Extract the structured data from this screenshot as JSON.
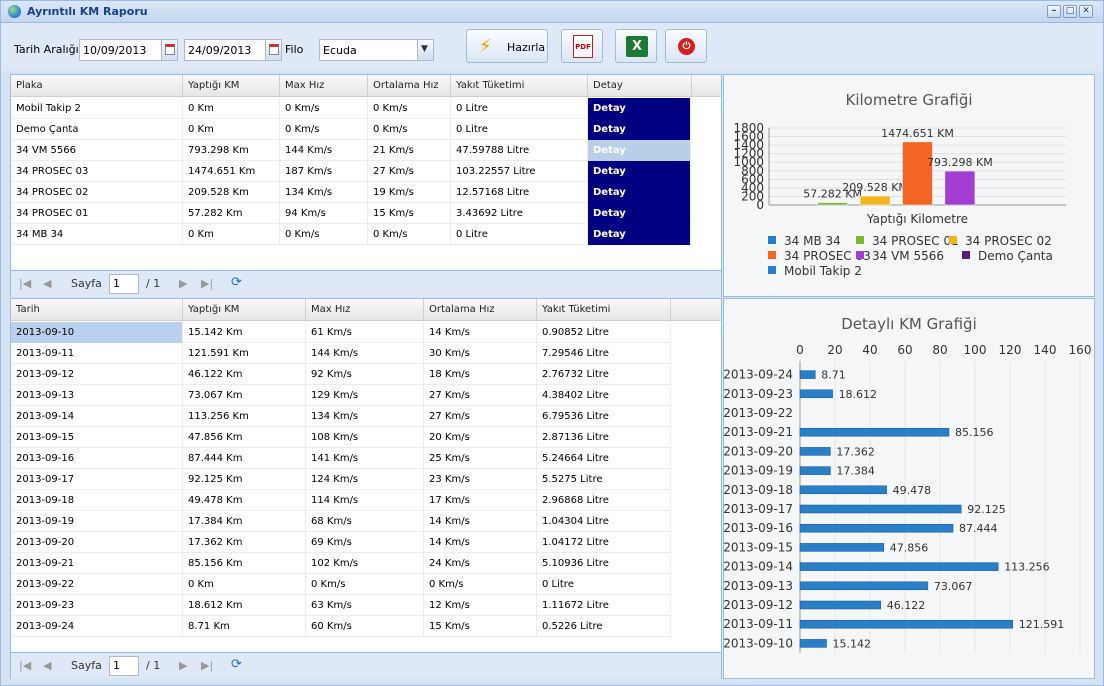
{
  "window": {
    "title": "Ayrıntılı KM Raporu"
  },
  "toolbar": {
    "date_range_label": "Tarih Aralığı",
    "start_date": "10/09/2013",
    "end_date": "24/09/2013",
    "fleet_label": "Filo",
    "fleet_value": "Ecuda",
    "prepare_label": "Hazırla"
  },
  "summary": {
    "headers": [
      "Plaka",
      "Yaptığı KM",
      "Max Hız",
      "Ortalama Hız",
      "Yakıt Tüketimi",
      "Detay"
    ],
    "rows": [
      [
        "Mobil Takip 2",
        "0 Km",
        "0 Km/s",
        "0 Km/s",
        "0 Litre",
        "Detay"
      ],
      [
        "Demo Çanta",
        "0 Km",
        "0 Km/s",
        "0 Km/s",
        "0 Litre",
        "Detay"
      ],
      [
        "34 VM 5566",
        "793.298 Km",
        "144 Km/s",
        "21 Km/s",
        "47.59788 Litre",
        "Detay"
      ],
      [
        "34 PROSEC 03",
        "1474.651 Km",
        "187 Km/s",
        "27 Km/s",
        "103.22557 Litre",
        "Detay"
      ],
      [
        "34 PROSEC 02",
        "209.528 Km",
        "134 Km/s",
        "19 Km/s",
        "12.57168 Litre",
        "Detay"
      ],
      [
        "34 PROSEC 01",
        "57.282 Km",
        "94 Km/s",
        "15 Km/s",
        "3.43692 Litre",
        "Detay"
      ],
      [
        "34 MB 34",
        "0 Km",
        "0 Km/s",
        "0 Km/s",
        "0 Litre",
        "Detay"
      ]
    ],
    "selected_row": 2
  },
  "pager1": {
    "page_label": "Sayfa",
    "page": "1",
    "total": "/ 1"
  },
  "detail": {
    "headers": [
      "Tarih",
      "Yaptığı KM",
      "Max Hız",
      "Ortalama Hız",
      "Yakıt Tüketimi"
    ],
    "rows": [
      [
        "2013-09-10",
        "15.142 Km",
        "61 Km/s",
        "14 Km/s",
        "0.90852 Litre"
      ],
      [
        "2013-09-11",
        "121.591 Km",
        "144 Km/s",
        "30 Km/s",
        "7.29546 Litre"
      ],
      [
        "2013-09-12",
        "46.122 Km",
        "92 Km/s",
        "18 Km/s",
        "2.76732 Litre"
      ],
      [
        "2013-09-13",
        "73.067 Km",
        "129 Km/s",
        "27 Km/s",
        "4.38402 Litre"
      ],
      [
        "2013-09-14",
        "113.256 Km",
        "134 Km/s",
        "27 Km/s",
        "6.79536 Litre"
      ],
      [
        "2013-09-15",
        "47.856 Km",
        "108 Km/s",
        "20 Km/s",
        "2.87136 Litre"
      ],
      [
        "2013-09-16",
        "87.444 Km",
        "141 Km/s",
        "25 Km/s",
        "5.24664 Litre"
      ],
      [
        "2013-09-17",
        "92.125 Km",
        "124 Km/s",
        "23 Km/s",
        "5.5275 Litre"
      ],
      [
        "2013-09-18",
        "49.478 Km",
        "114 Km/s",
        "17 Km/s",
        "2.96868 Litre"
      ],
      [
        "2013-09-19",
        "17.384 Km",
        "68 Km/s",
        "14 Km/s",
        "1.04304 Litre"
      ],
      [
        "2013-09-20",
        "17.362 Km",
        "69 Km/s",
        "14 Km/s",
        "1.04172 Litre"
      ],
      [
        "2013-09-21",
        "85.156 Km",
        "102 Km/s",
        "24 Km/s",
        "5.10936 Litre"
      ],
      [
        "2013-09-22",
        "0 Km",
        "0 Km/s",
        "0 Km/s",
        "0 Litre"
      ],
      [
        "2013-09-23",
        "18.612 Km",
        "63 Km/s",
        "12 Km/s",
        "1.11672 Litre"
      ],
      [
        "2013-09-24",
        "8.71 Km",
        "60 Km/s",
        "15 Km/s",
        "0.5226 Litre"
      ]
    ]
  },
  "pager2": {
    "page_label": "Sayfa",
    "page": "1",
    "total": "/ 1"
  },
  "chart_data": [
    {
      "type": "bar",
      "title": "Kilometre Grafiği",
      "xlabel": "Yaptığı Kilometre",
      "ylim": [
        0,
        1800
      ],
      "yticks": [
        0,
        200,
        400,
        600,
        800,
        1000,
        1200,
        1400,
        1600,
        1800
      ],
      "legend_placement": "bottom",
      "series": [
        {
          "name": "34 MB 34",
          "value": 0,
          "label": "",
          "color": "#1f7ed0"
        },
        {
          "name": "34 PROSEC 01",
          "value": 57.282,
          "label": "57.282 KM",
          "color": "#7cb82f"
        },
        {
          "name": "34 PROSEC 02",
          "value": 209.528,
          "label": "209.528 KM",
          "color": "#f5b31d"
        },
        {
          "name": "34 PROSEC 03",
          "value": 1474.651,
          "label": "1474.651 KM",
          "color": "#f26522"
        },
        {
          "name": "34 VM 5566",
          "value": 793.298,
          "label": "793.298 KM",
          "color": "#a43ed3"
        },
        {
          "name": "Demo Çanta",
          "value": 0,
          "label": "",
          "color": "#5c1c7a"
        },
        {
          "name": "Mobil Takip 2",
          "value": 0,
          "label": "",
          "color": "#1f7ed0"
        }
      ]
    },
    {
      "type": "bar",
      "orientation": "horizontal",
      "title": "Detaylı KM Grafiği",
      "xlim": [
        0,
        160
      ],
      "xticks": [
        0,
        20,
        40,
        60,
        80,
        100,
        120,
        140,
        160
      ],
      "color": "#2a7fc9",
      "categories": [
        "2013-09-24",
        "2013-09-23",
        "2013-09-22",
        "2013-09-21",
        "2013-09-20",
        "2013-09-19",
        "2013-09-18",
        "2013-09-17",
        "2013-09-16",
        "2013-09-15",
        "2013-09-14",
        "2013-09-13",
        "2013-09-12",
        "2013-09-11",
        "2013-09-10"
      ],
      "values": [
        8.71,
        18.612,
        0,
        85.156,
        17.362,
        17.384,
        49.478,
        92.125,
        87.444,
        47.856,
        113.256,
        73.067,
        46.122,
        121.591,
        15.142
      ],
      "labels": [
        "8.71",
        "18.612",
        "",
        "85.156",
        "17.362",
        "17.384",
        "49.478",
        "92.125",
        "87.444",
        "47.856",
        "113.256",
        "73.067",
        "46.122",
        "121.591",
        "15.142"
      ]
    }
  ]
}
